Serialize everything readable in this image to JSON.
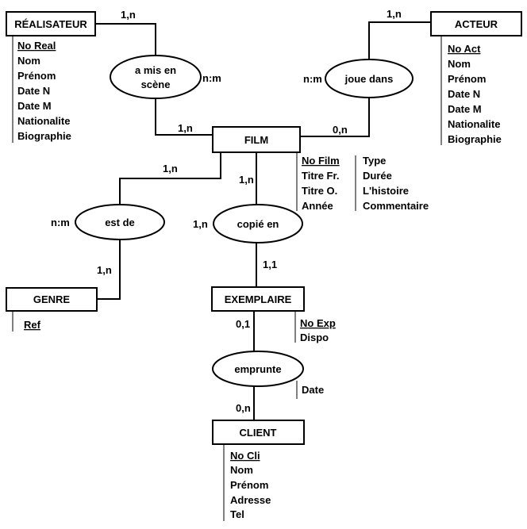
{
  "entities": {
    "realisateur": {
      "name": "RÉALISATEUR",
      "attributes": [
        "No Real",
        "Nom",
        "Prénom",
        "Date N",
        "Date M",
        "Nationalite",
        "Biographie"
      ]
    },
    "acteur": {
      "name": "ACTEUR",
      "attributes": [
        "No Act",
        "Nom",
        "Prénom",
        "Date N",
        "Date M",
        "Nationalite",
        "Biographie"
      ]
    },
    "film": {
      "name": "FILM",
      "attributes_col1": [
        "No Film",
        "Titre Fr.",
        "Titre O.",
        "Année"
      ],
      "attributes_col2": [
        "Type",
        "Durée",
        "L'histoire",
        "Commentaire"
      ]
    },
    "genre": {
      "name": "GENRE",
      "attributes": [
        "Ref"
      ]
    },
    "exemplaire": {
      "name": "EXEMPLAIRE",
      "attributes": [
        "No Exp",
        "Dispo"
      ]
    },
    "client": {
      "name": "CLIENT",
      "attributes": [
        "No Cli",
        "Nom",
        "Prénom",
        "Adresse",
        "Tel"
      ]
    }
  },
  "relations": {
    "a_mis_en_scene": {
      "line1": "a mis en",
      "line2": "scène",
      "type": "n:m",
      "card_realisateur": "1,n",
      "card_film": "1,n"
    },
    "joue_dans": {
      "name": "joue dans",
      "type": "n:m",
      "card_acteur": "1,n",
      "card_film": "0,n"
    },
    "est_de": {
      "name": "est de",
      "type": "n:m",
      "card_film": "1,n",
      "card_genre": "1,n"
    },
    "copie_en": {
      "name": "copié en",
      "card_left": "1,n",
      "card_film": "1,n",
      "card_exemplaire": "1,1"
    },
    "emprunte": {
      "name": "emprunte",
      "attribute": "Date",
      "card_exemplaire": "0,1",
      "card_client": "0,n"
    }
  }
}
